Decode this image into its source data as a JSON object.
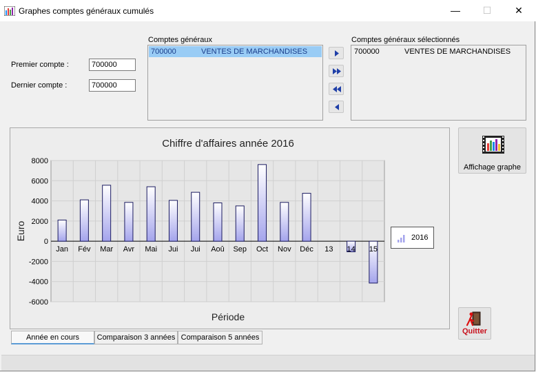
{
  "window": {
    "title": "Graphes comptes généraux cumulés",
    "minimize_glyph": "—",
    "maximize_glyph": "☐",
    "close_glyph": "✕"
  },
  "form": {
    "premier_label": "Premier compte :",
    "premier_value": "700000",
    "dernier_label": "Dernier compte :",
    "dernier_value": "700000"
  },
  "accounts_list": {
    "label": "Comptes généraux",
    "rows": [
      {
        "code": "700000",
        "name": "VENTES DE MARCHANDISES",
        "selected": true
      }
    ]
  },
  "selected_list": {
    "label": "Comptes généraux sélectionnés",
    "rows": [
      {
        "code": "700000",
        "name": "VENTES DE MARCHANDISES"
      }
    ]
  },
  "transfer_buttons": [
    "add-one-icon",
    "add-all-icon",
    "remove-all-icon",
    "remove-one-icon"
  ],
  "chart_data": {
    "type": "bar",
    "title": "Chiffre d'affaires année 2016",
    "xlabel": "Période",
    "ylabel": "Euro",
    "categories": [
      "Jan",
      "Fév",
      "Mar",
      "Avr",
      "Mai",
      "Jui",
      "Jui",
      "Aoû",
      "Sep",
      "Oct",
      "Nov",
      "Déc",
      "13",
      "14",
      "15"
    ],
    "series": [
      {
        "name": "2016",
        "values": [
          2100,
          4100,
          5550,
          3850,
          5400,
          4050,
          4850,
          3800,
          3500,
          7600,
          3850,
          4750,
          0,
          -1050,
          -4150
        ]
      }
    ],
    "ylim": [
      -6000,
      8000
    ],
    "yticks": [
      8000,
      6000,
      4000,
      2000,
      0,
      -2000,
      -4000,
      -6000
    ],
    "grid": true,
    "legend": "right",
    "colors": {
      "bar_top": "#ffffff",
      "bar_bottom": "#a4a4ec",
      "bar_stroke": "#1a1a60",
      "grid": "#cfcfcf",
      "plot_bg": "#e6e6e6"
    }
  },
  "buttons": {
    "affichage_label": "Affichage graphe",
    "quitter_label": "Quitter"
  },
  "tabs": [
    {
      "label": "Année en cours",
      "active": true
    },
    {
      "label": "Comparaison 3 années",
      "active": false
    },
    {
      "label": "Comparaison 5 années",
      "active": false
    }
  ]
}
